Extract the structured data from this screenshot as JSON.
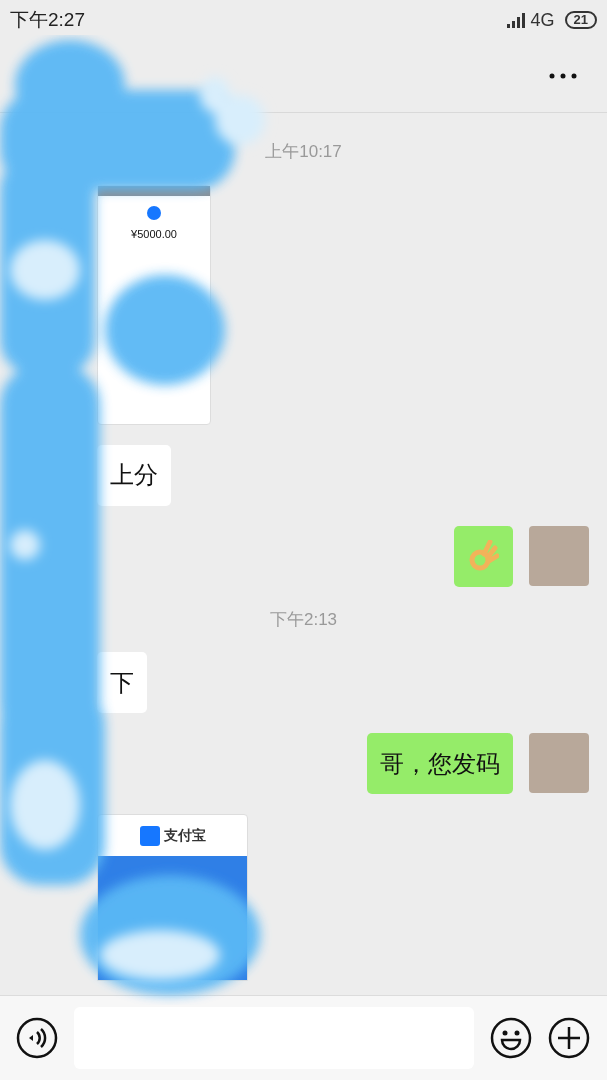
{
  "status_bar": {
    "time": "下午2:27",
    "network": "4G",
    "battery": "21"
  },
  "messages": [
    {
      "kind": "time",
      "text": "上午10:17"
    },
    {
      "kind": "receipt",
      "texts": [
        "¥5000.00"
      ]
    },
    {
      "kind": "incoming",
      "text": "上分"
    },
    {
      "kind": "sticker"
    },
    {
      "kind": "time",
      "text": "下午2:13"
    },
    {
      "kind": "incoming",
      "text": "下"
    },
    {
      "kind": "outgoing",
      "text": "哥，您发码"
    },
    {
      "kind": "banner",
      "texts": [
        "支付宝"
      ]
    }
  ]
}
